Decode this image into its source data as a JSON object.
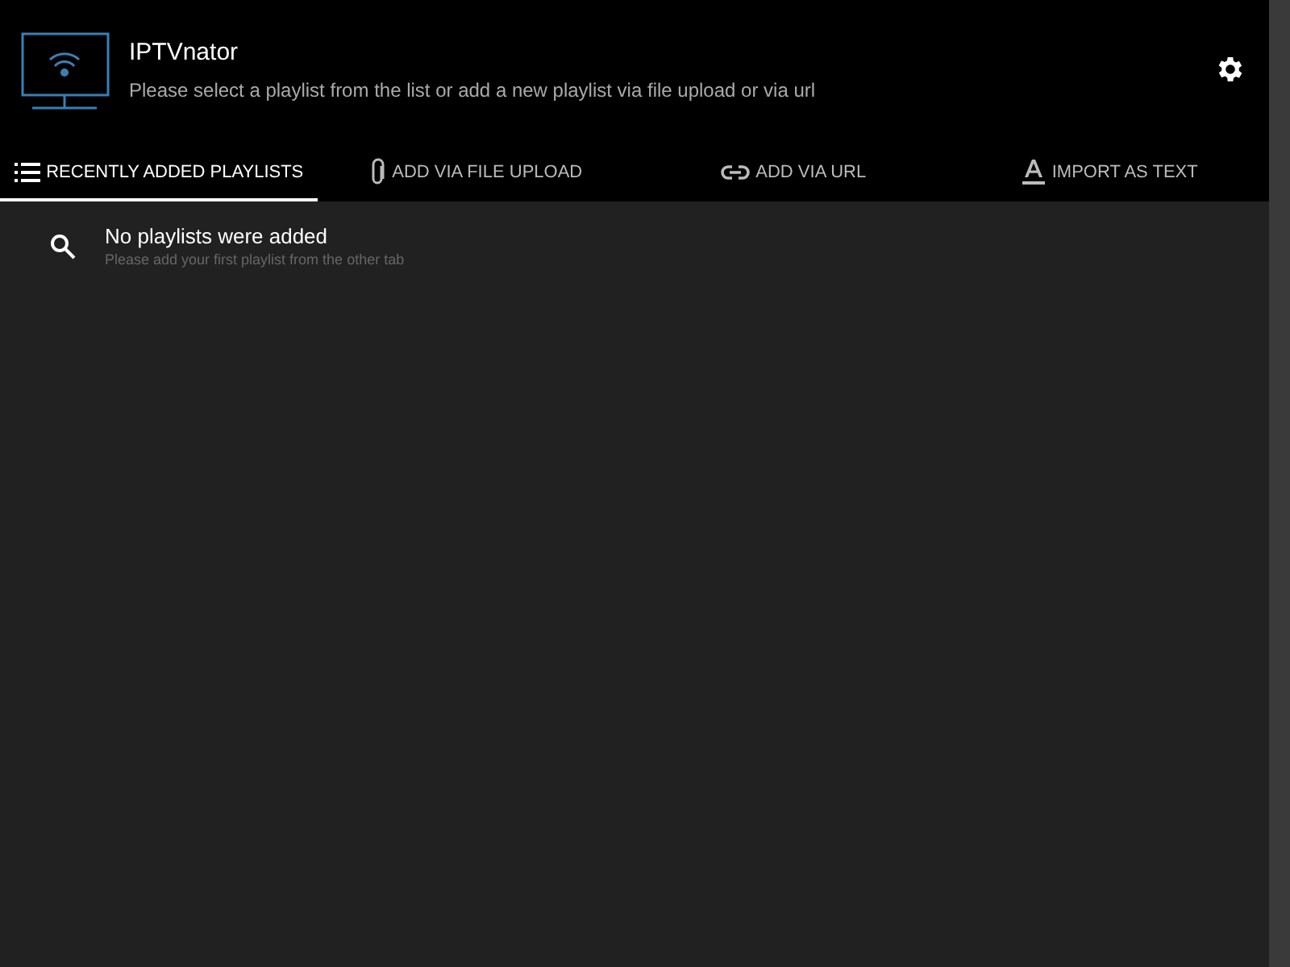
{
  "header": {
    "title": "IPTVnator",
    "subtitle": "Please select a playlist from the list or add a new playlist via file upload or via url"
  },
  "tabs": [
    {
      "label": "RECENTLY ADDED PLAYLISTS",
      "kind": "list",
      "selected": true
    },
    {
      "label": "ADD VIA FILE UPLOAD",
      "kind": "file",
      "selected": false
    },
    {
      "label": "ADD VIA URL",
      "kind": "url",
      "selected": false
    },
    {
      "label": "IMPORT AS TEXT",
      "kind": "text",
      "selected": false
    }
  ],
  "empty_state": {
    "title": "No playlists were added",
    "hint": "Please add your first playlist from the other tab"
  }
}
